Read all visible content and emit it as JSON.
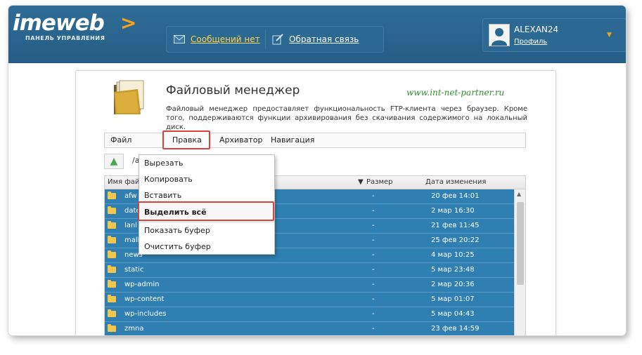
{
  "header": {
    "logo_text": "imeweb",
    "logo_arrow": ">",
    "logo_subtitle": "ПАНЕЛЬ УПРАВЛЕНИЯ",
    "messages_label": "Сообщений нет",
    "feedback_label": "Обратная связь",
    "username": "ALEXAN24",
    "profile_label": "Профиль",
    "caret": "▼",
    "icons": [
      "envelope-icon",
      "edit-icon",
      "avatar-icon"
    ]
  },
  "page": {
    "title": "Файловый менеджер",
    "watermark": "www.int-net-partner.ru",
    "description": "Файловый менеджер предоставляет функциональность FTP-клиента через браузер. Кроме того, поддерживаются функции архивирования без скачивания содержимого на локальный диск."
  },
  "menubar": {
    "items": [
      "Файл",
      "Правка",
      "Архиватор",
      "Навигация"
    ]
  },
  "path": {
    "value": "/a"
  },
  "dropdown": {
    "items": [
      "Вырезать",
      "Копировать",
      "Вставить",
      "Выделить всё",
      "Показать буфер",
      "Очистить буфер"
    ],
    "highlighted": "Выделить всё"
  },
  "table": {
    "columns": {
      "name": "Имя файла",
      "size": "Размер",
      "date": "Дата изменения"
    },
    "sort_indicator": "▼",
    "rows": [
      {
        "name": "afw",
        "size": "-",
        "date": "20 фев 14:01"
      },
      {
        "name": "date",
        "size": "-",
        "date": "2 мар 16:30"
      },
      {
        "name": "lanl",
        "size": "-",
        "date": "21 фев 11:45"
      },
      {
        "name": "malk",
        "size": "-",
        "date": "25 фев 20:22"
      },
      {
        "name": "news",
        "size": "-",
        "date": "4 мар 10:25"
      },
      {
        "name": "static",
        "size": "-",
        "date": "5 мар 23:48"
      },
      {
        "name": "wp-admin",
        "size": "-",
        "date": "2 мар 20:36"
      },
      {
        "name": "wp-content",
        "size": "-",
        "date": "5 мар 01:07"
      },
      {
        "name": "wp-includes",
        "size": "-",
        "date": "5 мар 04:43"
      },
      {
        "name": "zmna",
        "size": "-",
        "date": "23 фев 14:59"
      }
    ]
  },
  "colors": {
    "header_bg": "#2a6790",
    "accent_orange": "#f6a21d",
    "selected_row": "#2f7fb2",
    "highlight_border": "#e0403a",
    "watermark_green": "#2e8f2e"
  }
}
